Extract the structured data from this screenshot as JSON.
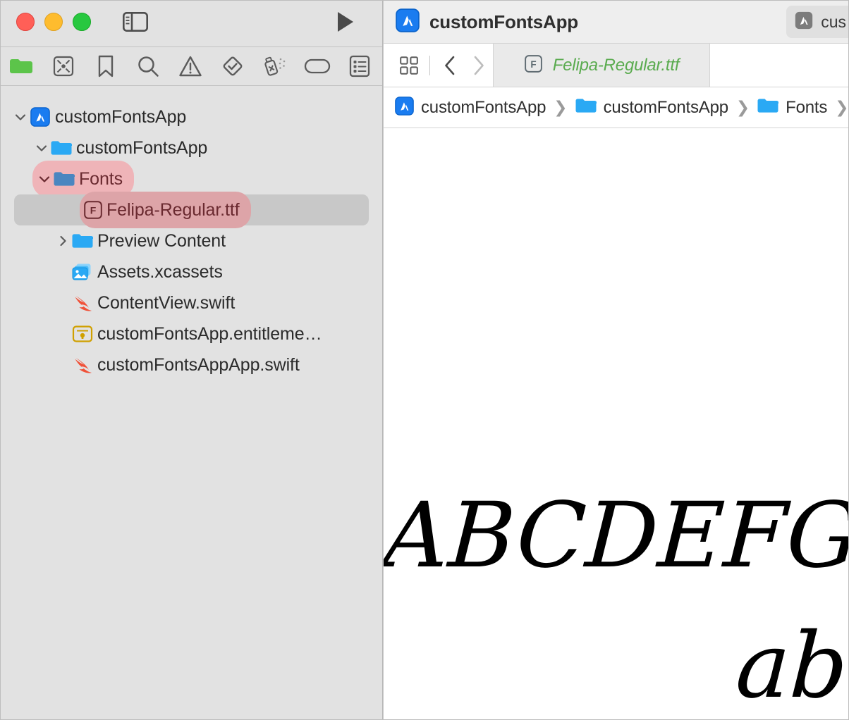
{
  "window": {
    "traffic_lights": {
      "close_color": "#ff5f57",
      "minimize_color": "#febc2e",
      "zoom_color": "#28c840"
    },
    "sidebar_toggle_icon": "sidebar-toggle-icon",
    "run_icon": "run-play-icon"
  },
  "navigator": {
    "tabs": [
      {
        "icon": "folder-icon",
        "name": "project-navigator",
        "active": true
      },
      {
        "icon": "source-control-icon",
        "name": "source-control-navigator",
        "active": false
      },
      {
        "icon": "bookmark-icon",
        "name": "bookmark-navigator",
        "active": false
      },
      {
        "icon": "search-icon",
        "name": "find-navigator",
        "active": false
      },
      {
        "icon": "warning-icon",
        "name": "issue-navigator",
        "active": false
      },
      {
        "icon": "test-diamond-icon",
        "name": "test-navigator",
        "active": false
      },
      {
        "icon": "spray-bottle-icon",
        "name": "debug-navigator",
        "active": false
      },
      {
        "icon": "tag-icon",
        "name": "breakpoint-navigator",
        "active": false
      },
      {
        "icon": "report-list-icon",
        "name": "report-navigator",
        "active": false
      }
    ],
    "tree": [
      {
        "label": "customFontsApp",
        "icon": "xcode-project-icon",
        "indent": 0,
        "disclosure": "expanded",
        "highlight": "none",
        "selected": false
      },
      {
        "label": "customFontsApp",
        "icon": "blue-folder-icon",
        "indent": 1,
        "disclosure": "expanded",
        "highlight": "none",
        "selected": false
      },
      {
        "label": "Fonts",
        "icon": "blue-folder-icon",
        "indent": 1,
        "disclosure": "expanded",
        "highlight": "light",
        "selected": false
      },
      {
        "label": "Felipa-Regular.ttf",
        "icon": "font-file-icon",
        "indent": 3,
        "disclosure": "none",
        "highlight": "dark",
        "selected": true
      },
      {
        "label": "Preview Content",
        "icon": "blue-folder-icon",
        "indent": 2,
        "disclosure": "collapsed",
        "highlight": "none",
        "selected": false
      },
      {
        "label": "Assets.xcassets",
        "icon": "assets-catalog-icon",
        "indent": 2,
        "disclosure": "none",
        "highlight": "none",
        "selected": false
      },
      {
        "label": "ContentView.swift",
        "icon": "swift-file-icon",
        "indent": 2,
        "disclosure": "none",
        "highlight": "none",
        "selected": false
      },
      {
        "label": "customFontsApp.entitleme…",
        "icon": "entitlements-icon",
        "indent": 2,
        "disclosure": "none",
        "highlight": "none",
        "selected": false
      },
      {
        "label": "customFontsAppApp.swift",
        "icon": "swift-file-icon",
        "indent": 2,
        "disclosure": "none",
        "highlight": "none",
        "selected": false
      }
    ]
  },
  "editor": {
    "app_title": "customFontsApp",
    "app_icon": "xcode-project-icon",
    "scheme_chip": {
      "icon": "xcode-scheme-icon",
      "label": "cus"
    },
    "toolbar": {
      "multipane_icon": "multipane-grid-icon",
      "back_icon": "chevron-left-icon",
      "forward_icon": "chevron-right-icon",
      "back_enabled": true,
      "forward_enabled": false
    },
    "tabs": [
      {
        "label": "Felipa-Regular.ttf",
        "icon": "font-file-icon",
        "active": true,
        "color": "#5aab4f"
      }
    ],
    "breadcrumb": [
      {
        "label": "customFontsApp",
        "icon": "xcode-project-icon"
      },
      {
        "label": "customFontsApp",
        "icon": "blue-folder-icon"
      },
      {
        "label": "Fonts",
        "icon": "blue-folder-icon"
      },
      {
        "label": "",
        "icon": "font-file-icon"
      }
    ],
    "breadcrumb_separator": "❯",
    "font_preview": {
      "uppercase_line": "ABCDEFGHIJ",
      "lowercase_line": "abcdefg"
    }
  },
  "colors": {
    "sidebar_bg": "#e2e2e2",
    "editor_bg": "#ffffff",
    "titlebar_bg": "#eeeeee",
    "tab_active_bg": "#eaeaea",
    "selection_row": "#c8c8c8",
    "highlight_light_pink": "#efb4b8",
    "highlight_dark_pink": "#dda4a8",
    "highlight_text": "#6a2a30",
    "tab_text_green": "#5aab4f",
    "folder_blue": "#2aa9f4",
    "folder_blue_muted": "#4a86c0",
    "swift_orange": "#f05138",
    "accent_blue": "#1a7cf0"
  }
}
